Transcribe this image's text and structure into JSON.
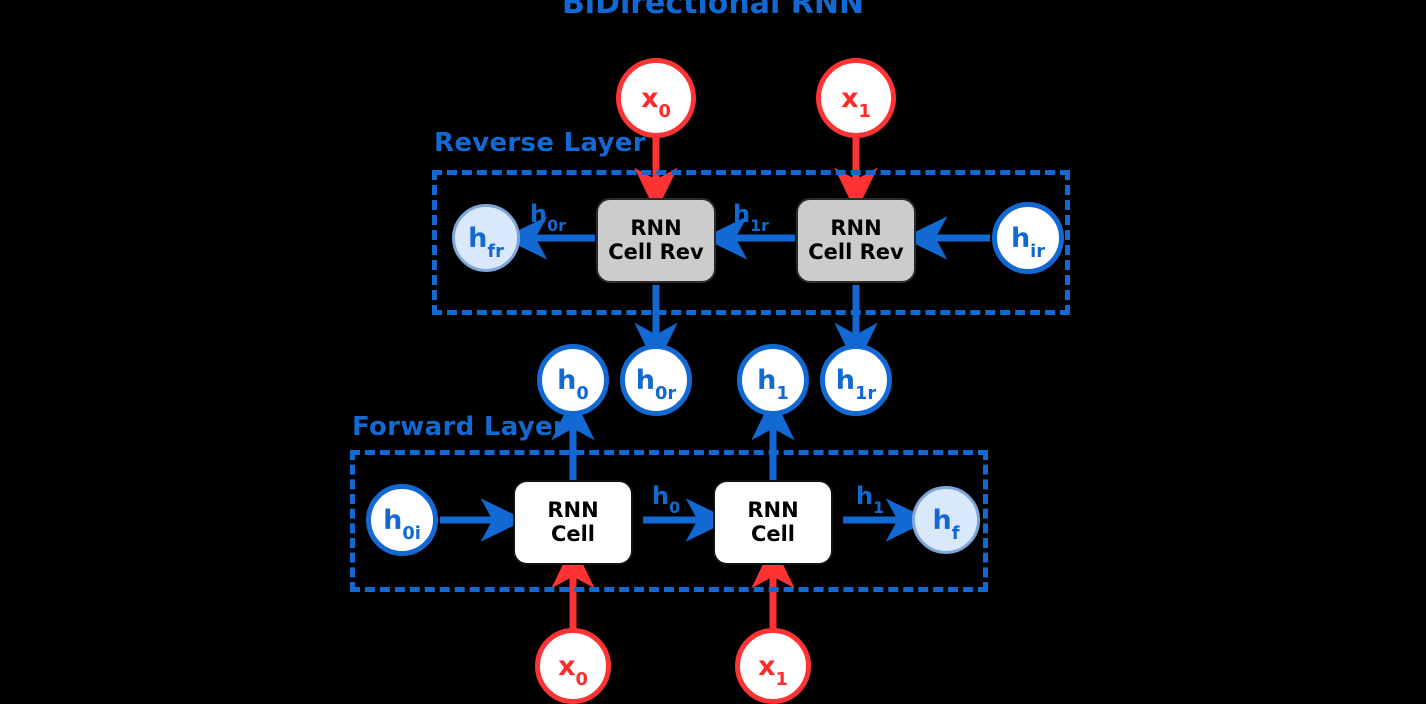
{
  "title": "BiDirectional RNN",
  "colors": {
    "accent_blue": "#1269d3",
    "input_red": "#ff3333",
    "reverse_cell_fill": "#cccccc",
    "final_state_fill": "#dae8fc",
    "final_state_stroke": "#7ea6d9",
    "background": "#000000"
  },
  "layers": {
    "reverse": {
      "label": "Reverse Layer",
      "cells": [
        {
          "line1": "RNN",
          "line2": "Cell Rev"
        },
        {
          "line1": "RNN",
          "line2": "Cell Rev"
        }
      ],
      "init_state": "h",
      "init_state_sub": "ir",
      "final_state": "h",
      "final_state_sub": "fr",
      "edge_labels": [
        {
          "base": "h",
          "sub": "0r"
        },
        {
          "base": "h",
          "sub": "1r"
        }
      ]
    },
    "forward": {
      "label": "Forward Layer",
      "cells": [
        {
          "line1": "RNN",
          "line2": "Cell"
        },
        {
          "line1": "RNN",
          "line2": "Cell"
        }
      ],
      "init_state": "h",
      "init_state_sub": "0i",
      "final_state": "h",
      "final_state_sub": "f",
      "edge_labels": [
        {
          "base": "h",
          "sub": "0"
        },
        {
          "base": "h",
          "sub": "1"
        }
      ]
    }
  },
  "inputs_top": [
    {
      "base": "x",
      "sub": "0"
    },
    {
      "base": "x",
      "sub": "1"
    }
  ],
  "inputs_bottom": [
    {
      "base": "x",
      "sub": "0"
    },
    {
      "base": "x",
      "sub": "1"
    }
  ],
  "outputs": [
    {
      "base": "h",
      "sub": "0"
    },
    {
      "base": "h",
      "sub": "0r"
    },
    {
      "base": "h",
      "sub": "1"
    },
    {
      "base": "h",
      "sub": "1r"
    }
  ]
}
